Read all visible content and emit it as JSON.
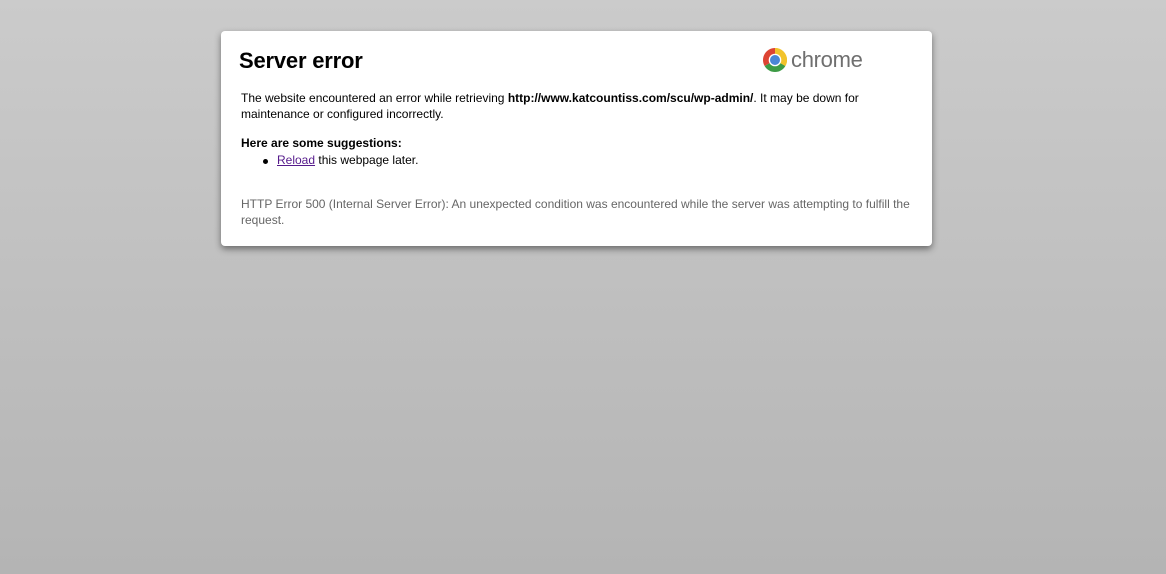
{
  "page": {
    "title": "Server error",
    "brand": {
      "icon": "chrome-logo-icon",
      "text": "chrome"
    },
    "message": {
      "prefix": "The website encountered an error while retrieving ",
      "url": "http://www.katcountiss.com/scu/wp-admin/",
      "suffix": ". It may be down for maintenance or configured incorrectly."
    },
    "suggestions": {
      "heading": "Here are some suggestions:",
      "items": [
        {
          "link_text": "Reload",
          "rest_text": " this webpage later."
        }
      ]
    },
    "error_detail": "HTTP Error 500 (Internal Server Error): An unexpected condition was encountered while the server was attempting to fulfill the request."
  },
  "colors": {
    "background_top": "#cbcbcb",
    "background_bottom": "#b4b4b4",
    "card": "#ffffff",
    "link": "#551a8b",
    "detail_text": "#666666",
    "brand_text": "#6f6f6f"
  }
}
